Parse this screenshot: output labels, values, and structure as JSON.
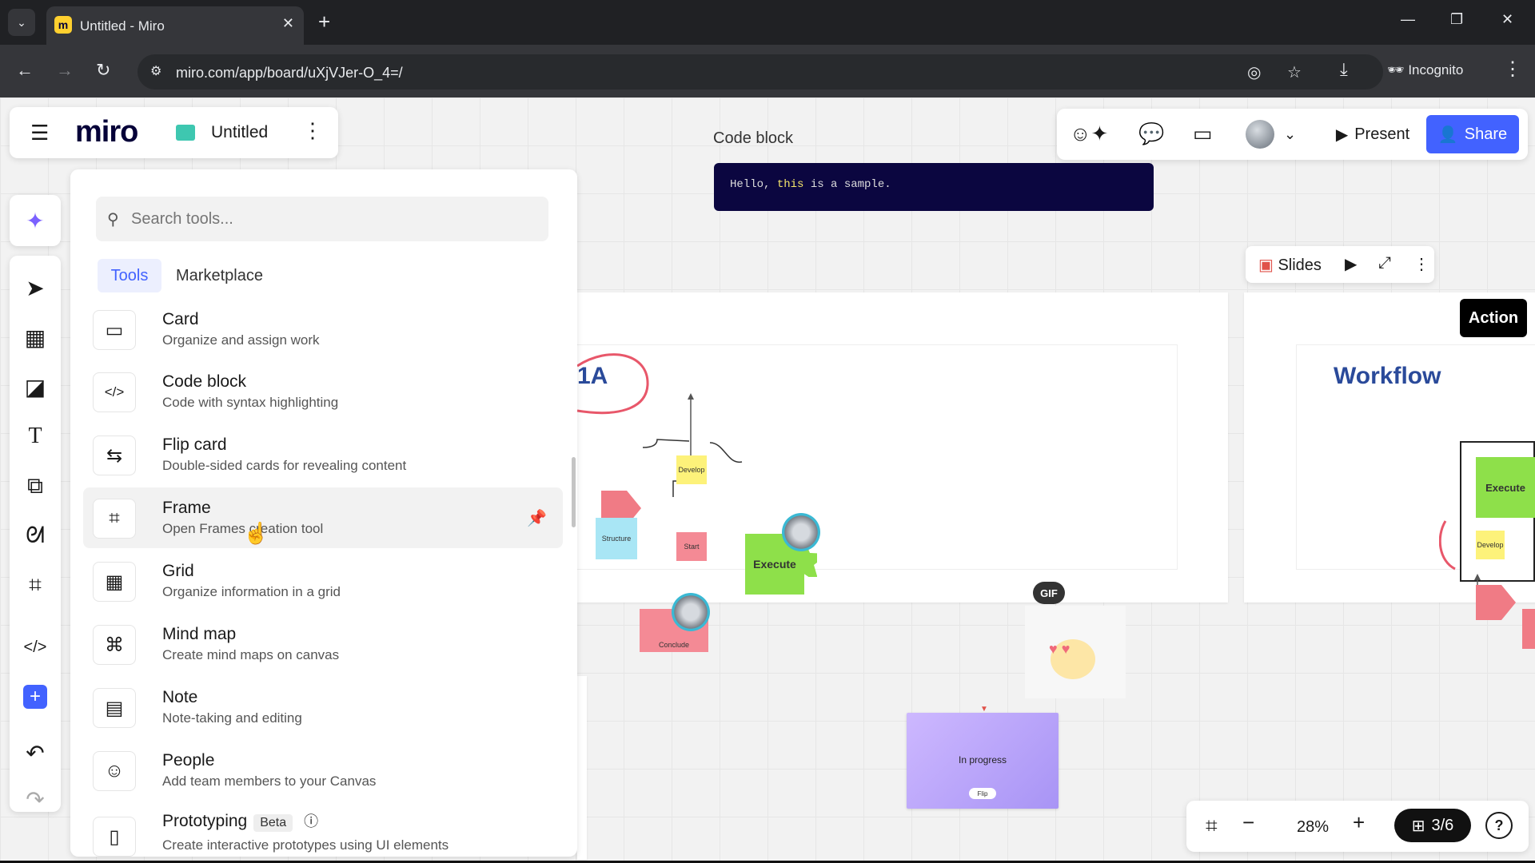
{
  "browser": {
    "tab_title": "Untitled - Miro",
    "tab_favicon": "miro-favicon",
    "url": "miro.com/app/board/uXjVJer-O_4=/",
    "profile_label": "Incognito"
  },
  "header": {
    "logo": "miro",
    "board_name": "Untitled",
    "present_label": "Present",
    "share_label": "Share",
    "accent_color": "#4262ff"
  },
  "tools_panel": {
    "search_placeholder": "Search tools...",
    "tabs": [
      {
        "label": "Tools",
        "active": true
      },
      {
        "label": "Marketplace",
        "active": false
      }
    ],
    "items": [
      {
        "title": "Card",
        "desc": "Organize and assign work",
        "icon": "card-icon"
      },
      {
        "title": "Code block",
        "desc": "Code with syntax highlighting",
        "icon": "code-block-icon"
      },
      {
        "title": "Flip card",
        "desc": "Double-sided cards for revealing content",
        "icon": "flip-card-icon"
      },
      {
        "title": "Frame",
        "desc": "Open Frames creation tool",
        "icon": "frame-icon",
        "hovered": true,
        "pinned": true
      },
      {
        "title": "Grid",
        "desc": "Organize information in a grid",
        "icon": "grid-icon"
      },
      {
        "title": "Mind map",
        "desc": "Create mind maps on canvas",
        "icon": "mind-map-icon"
      },
      {
        "title": "Note",
        "desc": "Note-taking and editing",
        "icon": "note-icon"
      },
      {
        "title": "People",
        "desc": "Add team members to your Canvas",
        "icon": "people-icon"
      },
      {
        "title": "Prototyping",
        "badge": "Beta",
        "desc": "Create interactive prototypes using UI elements",
        "icon": "prototyping-icon"
      }
    ]
  },
  "board": {
    "code_block_label": "Code block",
    "code_before": "Hello, ",
    "code_keyword": "this",
    "code_after": " is a sample.",
    "slides_label": "Slides",
    "action_label": "Action",
    "frame1_title": "1A",
    "frame2_title": "Workflow",
    "stickies": {
      "develop": "Develop",
      "structure": "Structure",
      "start": "Start",
      "execute": "Execute",
      "conclude": "Conclude",
      "execute2": "Execute",
      "develop2": "Develop"
    },
    "gif_label": "GIF",
    "in_progress_label": "In progress",
    "flip_pill": "Flip"
  },
  "zoom": {
    "percent": "28%",
    "pages": "3/6"
  }
}
